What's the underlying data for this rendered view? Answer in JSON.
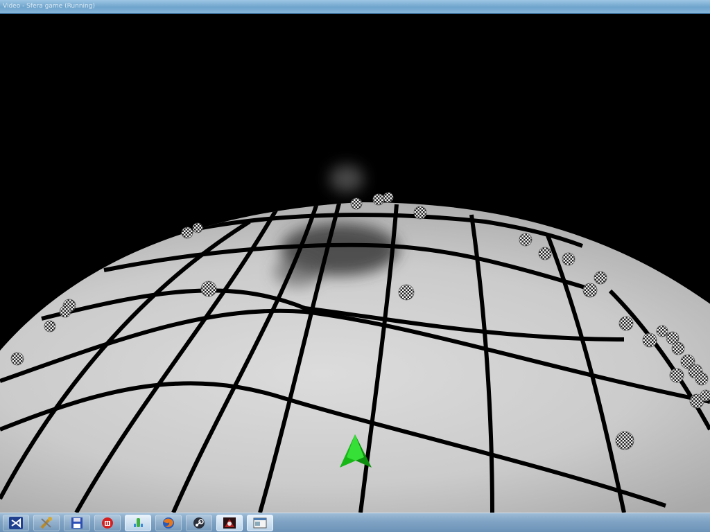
{
  "window": {
    "title": "Video - Sfera game (Running)"
  },
  "scene": {
    "player_marker_color": "#22cc22",
    "planet_color": "#c8c8c8",
    "grid_color": "#000000",
    "ball_style": "checkered"
  },
  "taskbar": {
    "apps": [
      {
        "name": "visual-studio-icon"
      },
      {
        "name": "tools-icon"
      },
      {
        "name": "save-disk-icon"
      },
      {
        "name": "red-app-icon"
      },
      {
        "name": "green-app-icon"
      },
      {
        "name": "firefox-icon"
      },
      {
        "name": "steam-icon"
      },
      {
        "name": "game-icon"
      },
      {
        "name": "window-app-icon"
      }
    ]
  }
}
